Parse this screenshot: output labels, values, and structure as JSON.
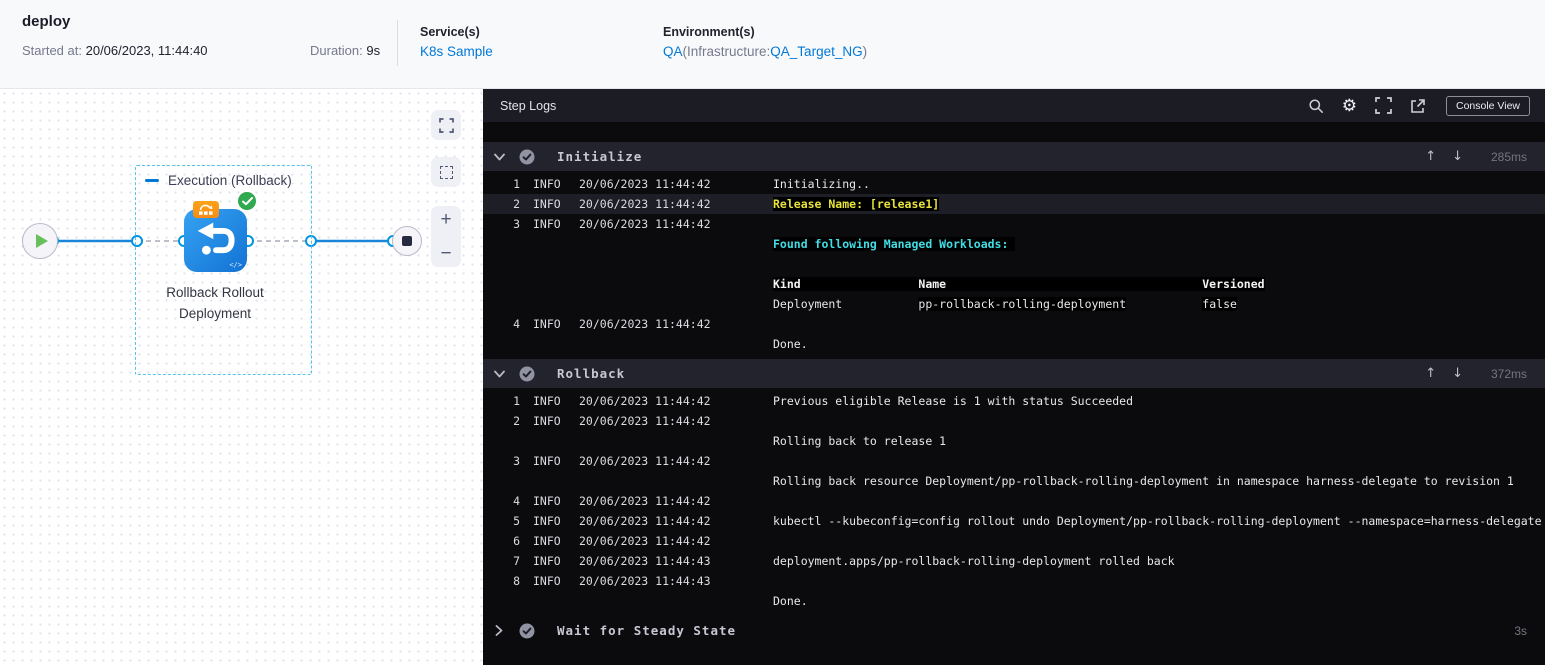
{
  "header": {
    "title": "deploy",
    "started_label": "Started at:",
    "started_value": "20/06/2023, 11:44:40",
    "duration_label": "Duration:",
    "duration_value": "9s",
    "services_label": "Service(s)",
    "service_name": "K8s Sample",
    "environments_label": "Environment(s)",
    "environment_name": "QA",
    "environment_infra_prefix": "(Infrastructure:",
    "environment_infra_name": "QA_Target_NG",
    "environment_suffix": ")"
  },
  "canvas": {
    "group_label": "Execution (Rollback)",
    "step_name_line1": "Rollback Rollout",
    "step_name_line2": "Deployment",
    "zoom_in_label": "+",
    "zoom_out_label": "−"
  },
  "logs": {
    "title": "Step Logs",
    "console_view_label": "Console View",
    "sections": [
      {
        "name": "Initialize",
        "duration": "285ms",
        "expanded": true,
        "lines": [
          {
            "n": "1",
            "level": "INFO",
            "ts": "20/06/2023 11:44:42",
            "segments": [
              {
                "text": "Initializing..",
                "style": "plain"
              }
            ]
          },
          {
            "n": "2",
            "level": "INFO",
            "ts": "20/06/2023 11:44:42",
            "highlight": true,
            "segments": [
              {
                "text": "Release Name: [release1]",
                "style": "yellow"
              }
            ]
          },
          {
            "n": "3",
            "level": "INFO",
            "ts": "20/06/2023 11:44:42",
            "segments": []
          },
          {
            "segments": [
              {
                "text": "Found following Managed Workloads: ",
                "style": "cyan"
              }
            ]
          },
          {
            "segments": []
          },
          {
            "segments": [
              {
                "text": "Kind                 Name                                     Versioned",
                "style": "header"
              }
            ]
          },
          {
            "segments": [
              {
                "text": "Deployment           ",
                "style": "plain"
              },
              {
                "text": "pp-rollback-rolling-deployment",
                "style": "darkbg"
              },
              {
                "text": "           ",
                "style": "plain"
              },
              {
                "text": "false",
                "style": "darkbg"
              }
            ]
          },
          {
            "n": "4",
            "level": "INFO",
            "ts": "20/06/2023 11:44:42",
            "segments": []
          },
          {
            "segments": [
              {
                "text": "Done.",
                "style": "plain"
              }
            ]
          }
        ]
      },
      {
        "name": "Rollback",
        "duration": "372ms",
        "expanded": true,
        "lines": [
          {
            "n": "1",
            "level": "INFO",
            "ts": "20/06/2023 11:44:42",
            "segments": [
              {
                "text": "Previous eligible Release is 1 with status Succeeded",
                "style": "plain"
              }
            ]
          },
          {
            "n": "2",
            "level": "INFO",
            "ts": "20/06/2023 11:44:42",
            "segments": []
          },
          {
            "segments": [
              {
                "text": "Rolling back to release 1",
                "style": "plain"
              }
            ]
          },
          {
            "n": "3",
            "level": "INFO",
            "ts": "20/06/2023 11:44:42",
            "segments": []
          },
          {
            "segments": [
              {
                "text": "Rolling back resource Deployment/pp-rollback-rolling-deployment in namespace harness-delegate to revision 1",
                "style": "plain"
              }
            ]
          },
          {
            "n": "4",
            "level": "INFO",
            "ts": "20/06/2023 11:44:42",
            "segments": []
          },
          {
            "n": "5",
            "level": "INFO",
            "ts": "20/06/2023 11:44:42",
            "segments": [
              {
                "text": "kubectl --kubeconfig=config rollout undo Deployment/pp-rollback-rolling-deployment --namespace=harness-delegate",
                "style": "plain"
              }
            ]
          },
          {
            "n": "6",
            "level": "INFO",
            "ts": "20/06/2023 11:44:42",
            "segments": []
          },
          {
            "n": "7",
            "level": "INFO",
            "ts": "20/06/2023 11:44:43",
            "segments": [
              {
                "text": "deployment.apps/pp-rollback-rolling-deployment rolled back",
                "style": "plain"
              }
            ]
          },
          {
            "n": "8",
            "level": "INFO",
            "ts": "20/06/2023 11:44:43",
            "segments": []
          },
          {
            "segments": [
              {
                "text": "Done.",
                "style": "plain"
              }
            ]
          }
        ]
      },
      {
        "name": "Wait for Steady State",
        "duration": "3s",
        "expanded": false,
        "lines": []
      }
    ]
  },
  "colors": {
    "accent_blue": "#0278d5",
    "log_yellow": "#e7e33c",
    "log_cyan": "#41dce4",
    "success_green": "#31a94f",
    "console_bg": "#0b0b0e",
    "section_header_bg": "#23232e"
  }
}
